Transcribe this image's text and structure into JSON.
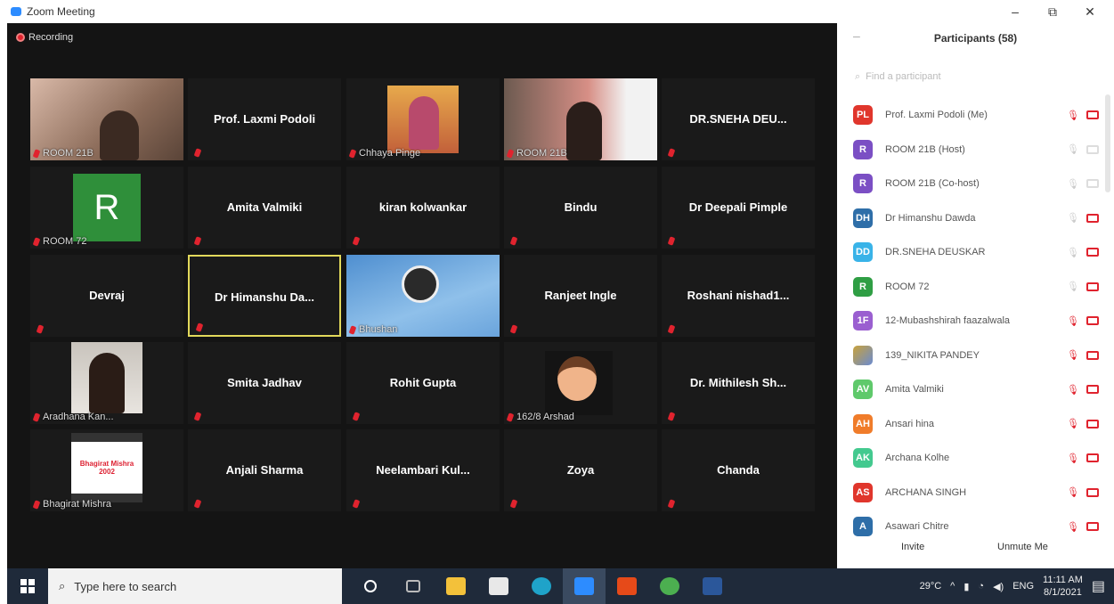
{
  "window": {
    "title": "Zoom Meeting",
    "minimize": "–",
    "restore": "⧉",
    "close": "✕"
  },
  "recording": {
    "label": "Recording"
  },
  "tiles": [
    {
      "name": "",
      "label": "ROOM 21B",
      "kind": "video1"
    },
    {
      "name": "Prof. Laxmi Podoli",
      "label": "",
      "kind": "name"
    },
    {
      "name": "",
      "label": "Chhaya Pinge",
      "kind": "video2"
    },
    {
      "name": "",
      "label": "ROOM 21B",
      "kind": "video3"
    },
    {
      "name": "DR.SNEHA  DEU...",
      "label": "",
      "kind": "name"
    },
    {
      "name": "",
      "label": "ROOM 72",
      "kind": "avatarR"
    },
    {
      "name": "Amita Valmiki",
      "label": "",
      "kind": "name"
    },
    {
      "name": "kiran kolwankar",
      "label": "",
      "kind": "name"
    },
    {
      "name": "Bindu",
      "label": "",
      "kind": "name"
    },
    {
      "name": "Dr Deepali Pimple",
      "label": "",
      "kind": "name"
    },
    {
      "name": "Devraj",
      "label": "",
      "kind": "name"
    },
    {
      "name": "Dr Himanshu  Da...",
      "label": "",
      "kind": "name-active"
    },
    {
      "name": "",
      "label": "Bhushan",
      "kind": "obs"
    },
    {
      "name": "Ranjeet Ingle",
      "label": "",
      "kind": "name"
    },
    {
      "name": "Roshani  nishad1...",
      "label": "",
      "kind": "name"
    },
    {
      "name": "",
      "label": "Aradhana Kan...",
      "kind": "video4"
    },
    {
      "name": "Smita Jadhav",
      "label": "",
      "kind": "name"
    },
    {
      "name": "Rohit Gupta",
      "label": "",
      "kind": "name"
    },
    {
      "name": "",
      "label": "162/8 Arshad",
      "kind": "emoji"
    },
    {
      "name": "Dr. Mithilesh  Sh...",
      "label": "",
      "kind": "name"
    },
    {
      "name": "",
      "label": "Bhagirat Mishra",
      "kind": "card"
    },
    {
      "name": "Anjali Sharma",
      "label": "",
      "kind": "name"
    },
    {
      "name": "Neelambari  Kul...",
      "label": "",
      "kind": "name"
    },
    {
      "name": "Zoya",
      "label": "",
      "kind": "name"
    },
    {
      "name": "Chanda",
      "label": "",
      "kind": "name"
    }
  ],
  "avatar_tile_letter": "R",
  "card_text": {
    "line1": "Bhagirat Mishra",
    "line2": "2002"
  },
  "participants": {
    "title": "Participants (58)",
    "collapse": "–",
    "search_placeholder": "Find a participant",
    "items": [
      {
        "initials": "PL",
        "name": "Prof. Laxmi Podoli (Me)",
        "color": "#e0362c",
        "state": "muted"
      },
      {
        "initials": "R",
        "name": "ROOM 21B (Host)",
        "color": "#7b4fc4",
        "state": "gray"
      },
      {
        "initials": "R",
        "name": "ROOM 21B (Co-host)",
        "color": "#7b4fc4",
        "state": "gray"
      },
      {
        "initials": "DH",
        "name": "Dr Himanshu Dawda",
        "color": "#2e6ea8",
        "state": "cam"
      },
      {
        "initials": "DD",
        "name": "DR.SNEHA DEUSKAR",
        "color": "#39b3e8",
        "state": "cam"
      },
      {
        "initials": "R",
        "name": "ROOM 72",
        "color": "#2f9e44",
        "state": "cam"
      },
      {
        "initials": "1F",
        "name": "12-Mubashshirah faazalwala",
        "color": "#9a5fd0",
        "state": "muted"
      },
      {
        "initials": "",
        "name": "139_NIKITA PANDEY",
        "color": "#c9a23a",
        "state": "muted"
      },
      {
        "initials": "AV",
        "name": "Amita Valmiki",
        "color": "#5fc96b",
        "state": "muted"
      },
      {
        "initials": "AH",
        "name": "Ansari hina",
        "color": "#f07c2a",
        "state": "muted"
      },
      {
        "initials": "AK",
        "name": "Archana Kolhe",
        "color": "#43c98f",
        "state": "muted"
      },
      {
        "initials": "AS",
        "name": "ARCHANA SINGH",
        "color": "#e0362c",
        "state": "muted"
      },
      {
        "initials": "A",
        "name": "Asawari Chitre",
        "color": "#2e6ea8",
        "state": "muted"
      }
    ],
    "invite": "Invite",
    "unmute": "Unmute Me"
  },
  "taskbar": {
    "search_placeholder": "Type here to search",
    "temperature": "29°C",
    "language": "ENG",
    "time": "11:11 AM",
    "date": "8/1/2021"
  }
}
